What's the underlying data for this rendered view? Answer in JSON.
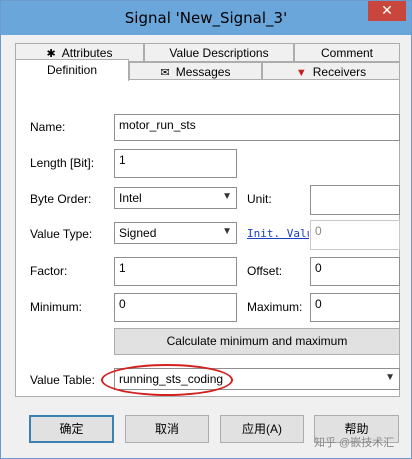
{
  "window": {
    "title": "Signal 'New_Signal_3'",
    "close_glyph": "✕"
  },
  "tabs_row1": [
    {
      "label": "Attributes",
      "icon": "attributes-icon"
    },
    {
      "label": "Value Descriptions"
    },
    {
      "label": "Comment"
    }
  ],
  "tabs_row2": [
    {
      "label": "Definition",
      "active": true
    },
    {
      "label": "Messages",
      "icon": "envelope-icon"
    },
    {
      "label": "Receivers",
      "icon": "receivers-icon"
    }
  ],
  "form": {
    "name_label": "Name:",
    "name_value": "motor_run_sts",
    "length_label": "Length [Bit]:",
    "length_value": "1",
    "byte_order_label": "Byte Order:",
    "byte_order_value": "Intel",
    "unit_label": "Unit:",
    "unit_value": "",
    "value_type_label": "Value Type:",
    "value_type_value": "Signed",
    "init_value_link": "Init. Value",
    "init_value": "0",
    "factor_label": "Factor:",
    "factor_value": "1",
    "offset_label": "Offset:",
    "offset_value": "0",
    "minimum_label": "Minimum:",
    "minimum_value": "0",
    "maximum_label": "Maximum:",
    "maximum_value": "0",
    "calc_button": "Calculate minimum and maximum",
    "value_table_label": "Value Table:",
    "value_table_value": "running_sts_coding"
  },
  "buttons": {
    "ok": "确定",
    "cancel": "取消",
    "apply": "应用(A)",
    "help": "帮助"
  },
  "watermark": "知乎 @嵌技术汇",
  "colors": {
    "titlebar": "#6ba6db",
    "close": "#c9463d",
    "highlight": "#d32020",
    "link": "#1a3dc4"
  }
}
